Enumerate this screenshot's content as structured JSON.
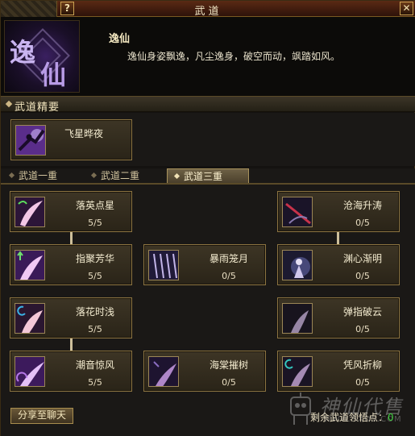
{
  "window": {
    "title": "武道",
    "help_label": "?",
    "close_label": "✕"
  },
  "header": {
    "portrait_glyph_1": "逸",
    "portrait_glyph_2": "仙",
    "name": "逸仙",
    "description": "逸仙身姿飘逸，凡尘逸身，破空而动，飒踏如风。"
  },
  "essence": {
    "section_title": "武道精要",
    "skill": {
      "name": "飞星晔夜",
      "icon": "flying-figure-icon"
    }
  },
  "tabs": [
    {
      "label": "武道一重",
      "active": false
    },
    {
      "label": "武道二重",
      "active": false
    },
    {
      "label": "武道三重",
      "active": true
    }
  ],
  "skills": [
    {
      "name": "落英点星",
      "count": "5/5",
      "icon": "green-swirl-blade-icon"
    },
    {
      "name": "沧海升涛",
      "count": "0/5",
      "icon": "red-slash-icon"
    },
    {
      "name": "指聚芳华",
      "count": "5/5",
      "icon": "trident-blade-icon"
    },
    {
      "name": "暴雨笼月",
      "count": "0/5",
      "icon": "rain-streaks-icon"
    },
    {
      "name": "渊心渐明",
      "count": "0/5",
      "icon": "dark-figure-icon"
    },
    {
      "name": "落花时浅",
      "count": "5/5",
      "icon": "blue-moon-blade-icon"
    },
    {
      "name": "弹指破云",
      "count": "0/5",
      "icon": "pale-blade-icon"
    },
    {
      "name": "潮音惊风",
      "count": "5/5",
      "icon": "purple-swirl-icon"
    },
    {
      "name": "海棠摧树",
      "count": "0/5",
      "icon": "violet-blade-icon"
    },
    {
      "name": "凭风折柳",
      "count": "0/5",
      "icon": "teal-moon-blade-icon"
    }
  ],
  "footer": {
    "share_label": "分享至聊天",
    "points_label": "剩余武道领悟点：",
    "points_value": "0"
  },
  "watermark": {
    "text": "神仙代售",
    "sub": "WWW.SXDS.COM"
  },
  "colors": {
    "accent_gold": "#c9a252",
    "points_green": "#3fd23f",
    "panel_bg": "#1a1816"
  }
}
